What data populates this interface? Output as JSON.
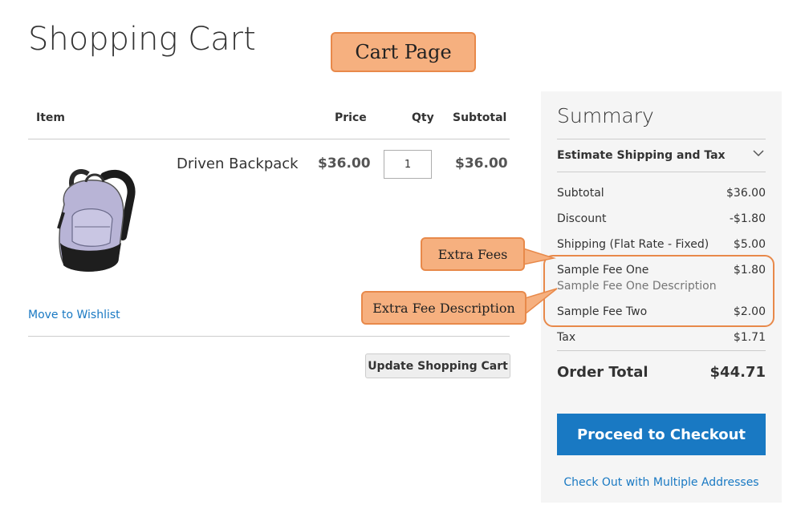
{
  "page": {
    "title": "Shopping Cart"
  },
  "annotations": {
    "cart_page": "Cart Page",
    "extra_fees": "Extra Fees",
    "extra_fee_description": "Extra Fee Description"
  },
  "colors": {
    "accent": "#1979c3",
    "callout_fill": "#f6b07f",
    "callout_border": "#e8894a",
    "summary_bg": "#f5f5f5"
  },
  "cart": {
    "headers": {
      "item": "Item",
      "price": "Price",
      "qty": "Qty",
      "subtotal": "Subtotal"
    },
    "items": [
      {
        "name": "Driven Backpack",
        "price": "$36.00",
        "qty": "1",
        "subtotal": "$36.00",
        "image_icon": "backpack-image"
      }
    ],
    "wishlist_label": "Move to Wishlist",
    "update_label": "Update Shopping Cart"
  },
  "summary": {
    "title": "Summary",
    "estimate_label": "Estimate Shipping and Tax",
    "rows": {
      "subtotal": {
        "label": "Subtotal",
        "value": "$36.00"
      },
      "discount": {
        "label": "Discount",
        "value": "-$1.80"
      },
      "shipping": {
        "label": "Shipping (Flat Rate - Fixed)",
        "value": "$5.00"
      },
      "fee_one": {
        "label": "Sample Fee One",
        "value": "$1.80",
        "description": "Sample Fee One Description"
      },
      "fee_two": {
        "label": "Sample Fee Two",
        "value": "$2.00"
      },
      "tax": {
        "label": "Tax",
        "value": "$1.71"
      }
    },
    "total_label": "Order Total",
    "total_value": "$44.71",
    "checkout_label": "Proceed to Checkout",
    "multi_address_label": "Check Out with Multiple Addresses"
  }
}
